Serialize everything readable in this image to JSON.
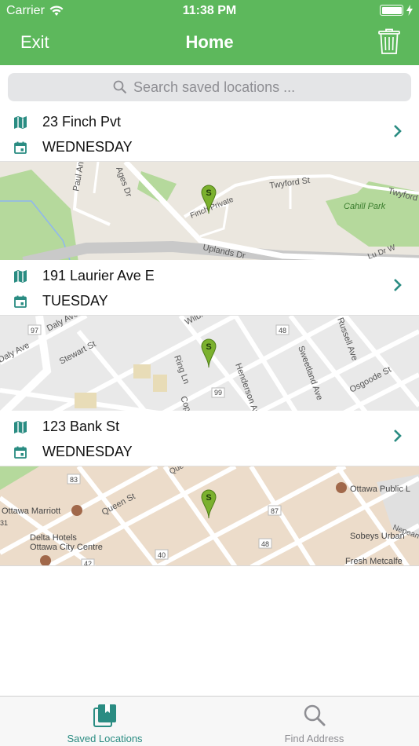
{
  "status_bar": {
    "carrier": "Carrier",
    "time": "11:38 PM",
    "battery_level": 1.0
  },
  "nav": {
    "left_button": "Exit",
    "title": "Home",
    "right_icon": "trash-icon"
  },
  "search": {
    "placeholder": "Search saved locations ..."
  },
  "colors": {
    "brand_green": "#5db85c",
    "accent_teal": "#2a8c82",
    "marker_green": "#7bb12e"
  },
  "locations": [
    {
      "name": "23 Finch Pvt",
      "day": "WEDNESDAY",
      "map_labels": [
        "Paul Anka Dr",
        "Ages Dr",
        "Twyford St",
        "Twyford",
        "Cahill Park",
        "Finch Private",
        "Uplands Dr",
        "Lu Dr W"
      ],
      "marker": "S"
    },
    {
      "name": "191 Laurier Ave E",
      "day": "TUESDAY",
      "map_labels": [
        "97",
        "Daly Ave",
        "Daly Ave",
        "Stewart St",
        "Wilbrod",
        "Henderson Ave",
        "Russell Ave",
        "Sweetland Ave",
        "Osgoode St",
        "Ring Ln",
        "Cope",
        "99",
        "48"
      ],
      "marker": "S"
    },
    {
      "name": "123 Bank St",
      "day": "WEDNESDAY",
      "map_labels": [
        "83",
        "Queen St",
        "Ottawa Marriott",
        "Delta Hotels",
        "Ottawa City Centre",
        "Ottawa Public L",
        "87",
        "Sobeys Urban",
        "Fresh Metcalfe",
        "Nepean",
        "40",
        "42",
        "48",
        "31",
        "Que"
      ],
      "marker": "S"
    }
  ],
  "tabs": [
    {
      "label": "Saved Locations",
      "icon": "saved-locations-icon",
      "active": true
    },
    {
      "label": "Find Address",
      "icon": "search-icon",
      "active": false
    }
  ]
}
